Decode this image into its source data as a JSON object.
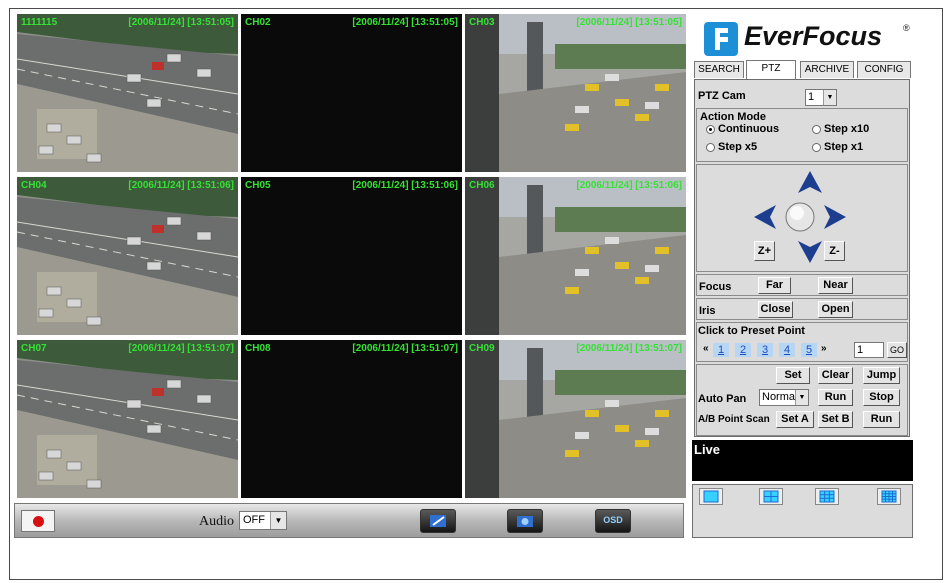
{
  "channels": [
    {
      "label": "1111115",
      "timestamp": "[2006/11/24] [13:51:05]",
      "scene": "street"
    },
    {
      "label": "CH02",
      "timestamp": "[2006/11/24] [13:51:05]",
      "scene": "dark"
    },
    {
      "label": "CH03",
      "timestamp": "[2006/11/24] [13:51:05]",
      "scene": "plaza"
    },
    {
      "label": "CH04",
      "timestamp": "[2006/11/24] [13:51:06]",
      "scene": "street"
    },
    {
      "label": "CH05",
      "timestamp": "[2006/11/24] [13:51:06]",
      "scene": "dark"
    },
    {
      "label": "CH06",
      "timestamp": "[2006/11/24] [13:51:06]",
      "scene": "plaza"
    },
    {
      "label": "CH07",
      "timestamp": "[2006/11/24] [13:51:07]",
      "scene": "street"
    },
    {
      "label": "CH08",
      "timestamp": "[2006/11/24] [13:51:07]",
      "scene": "dark"
    },
    {
      "label": "CH09",
      "timestamp": "[2006/11/24] [13:51:07]",
      "scene": "plaza"
    }
  ],
  "bottom_bar": {
    "audio_label": "Audio",
    "audio_value": "OFF",
    "osd_label": "OSD",
    "icons": [
      "record-icon",
      "snapshot-icon",
      "camera-icon",
      "osd-icon"
    ]
  },
  "brand": {
    "name": "EverFocus",
    "reg": "®"
  },
  "tabs": [
    "SEARCH",
    "PTZ",
    "ARCHIVE",
    "CONFIG"
  ],
  "active_tab": "PTZ",
  "ptz": {
    "cam_label": "PTZ Cam",
    "cam_value": "1",
    "action_mode_label": "Action Mode",
    "modes": [
      "Continuous",
      "Step x10",
      "Step x5",
      "Step x1"
    ],
    "selected_mode": "Continuous",
    "zoom_in": "Z+",
    "zoom_out": "Z-",
    "focus_label": "Focus",
    "focus_far": "Far",
    "focus_near": "Near",
    "iris_label": "Iris",
    "iris_close": "Close",
    "iris_open": "Open",
    "preset_title": "Click to Preset Point",
    "presets": [
      "1",
      "2",
      "3",
      "4",
      "5"
    ],
    "preset_input": "1",
    "go_label": "GO",
    "set_label": "Set",
    "clear_label": "Clear",
    "jump_label": "Jump",
    "auto_pan_label": "Auto Pan",
    "auto_pan_value": "Norma",
    "run_label": "Run",
    "stop_label": "Stop",
    "ab_scan_label": "A/B Point Scan",
    "set_a_label": "Set A",
    "set_b_label": "Set B",
    "run2_label": "Run"
  },
  "status": {
    "text": "Live"
  },
  "layout_buttons": [
    "single-view",
    "quad-view",
    "nine-view",
    "sixteen-view"
  ],
  "colors": {
    "osd_text": "#34e234",
    "accent": "#1c8fd6",
    "arrow": "#1d3d8f"
  }
}
